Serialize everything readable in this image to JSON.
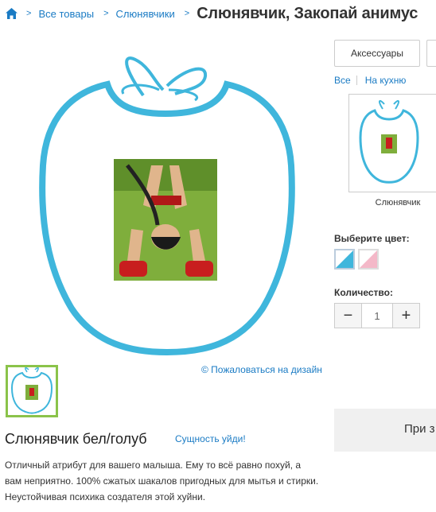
{
  "breadcrumb": {
    "home_icon": "home-icon",
    "separator": ">",
    "items": [
      {
        "label": "Все товары"
      },
      {
        "label": "Слюнявчики"
      }
    ],
    "current": "Слюнявчик, Закопай анимус"
  },
  "gallery": {
    "complain_link": "© Пожаловаться на дизайн"
  },
  "product": {
    "title": "Слюнявчик бел/голуб",
    "subtitle_link": "Сущность уйди!",
    "description": "Отличный атрибут для вашего малыша. Ему то всё равно похуй, а вам неприятно. 100% сжатых шакалов пригодных для мытья и стирки. Неустойчивая психика создателя этой хуйни."
  },
  "sidebar": {
    "tabs": [
      {
        "label": "Аксессуары"
      }
    ],
    "filters": [
      {
        "label": "Все"
      },
      {
        "label": "На кухню"
      }
    ],
    "product_type": {
      "label": "Слюнявчик"
    },
    "color_label": "Выберите цвет:",
    "colors": [
      {
        "name": "white/blue",
        "primary": "#3fb6dc",
        "secondary": "#ffffff"
      },
      {
        "name": "white/pink",
        "primary": "#f4b8c8",
        "secondary": "#ffffff"
      }
    ],
    "quantity_label": "Количество:",
    "quantity": {
      "minus": "−",
      "value": "1",
      "plus": "+"
    },
    "buy_label": "При з"
  },
  "colors": {
    "accent": "#1a7bc4",
    "bib_trim": "#3fb6dc",
    "thumb_border": "#8bc34a"
  }
}
